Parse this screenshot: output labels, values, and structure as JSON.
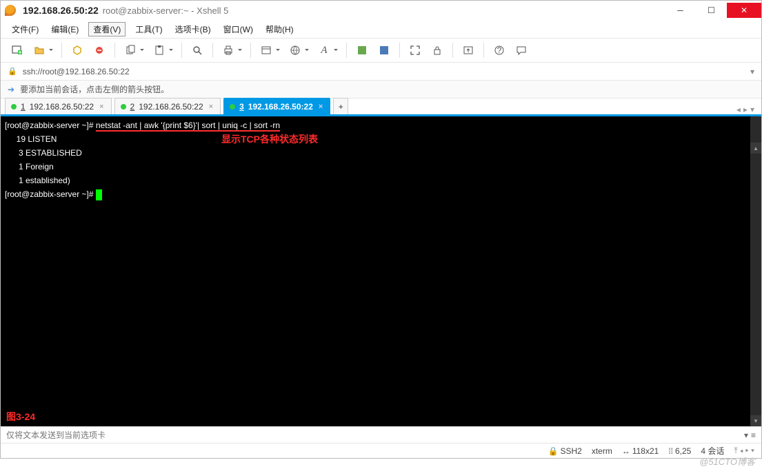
{
  "title": {
    "bold": "192.168.26.50:22",
    "rest": "root@zabbix-server:~ - Xshell 5"
  },
  "menu": {
    "file": "文件(F)",
    "edit": "编辑(E)",
    "view": "查看(V)",
    "tools": "工具(T)",
    "tabs": "选项卡(B)",
    "window": "窗口(W)",
    "help": "帮助(H)"
  },
  "address": {
    "url": "ssh://root@192.168.26.50:22"
  },
  "hint": "要添加当前会话，点击左侧的箭头按钮。",
  "tabs": [
    {
      "num": "1",
      "label": "192.168.26.50:22",
      "active": false
    },
    {
      "num": "2",
      "label": "192.168.26.50:22",
      "active": false
    },
    {
      "num": "3",
      "label": "192.168.26.50:22",
      "active": true
    }
  ],
  "terminal": {
    "prompt": "[root@zabbix-server ~]# ",
    "cmd": "netstat -ant | awk '{print $6}'| sort | uniq -c | sort -rn",
    "lines": [
      "     19 LISTEN",
      "      3 ESTABLISHED",
      "      1 Foreign",
      "      1 established)"
    ],
    "prompt2": "[root@zabbix-server ~]# ",
    "annotation": "显示TCP各种状态列表",
    "figure": "图3-24"
  },
  "inputbar": {
    "placeholder": "仅将文本发送到当前选项卡"
  },
  "status": {
    "proto": "SSH2",
    "term": "xterm",
    "size": "118x21",
    "cursor": "6,25",
    "sessions_label": "4 会话"
  },
  "watermark": "@51CTO博客"
}
